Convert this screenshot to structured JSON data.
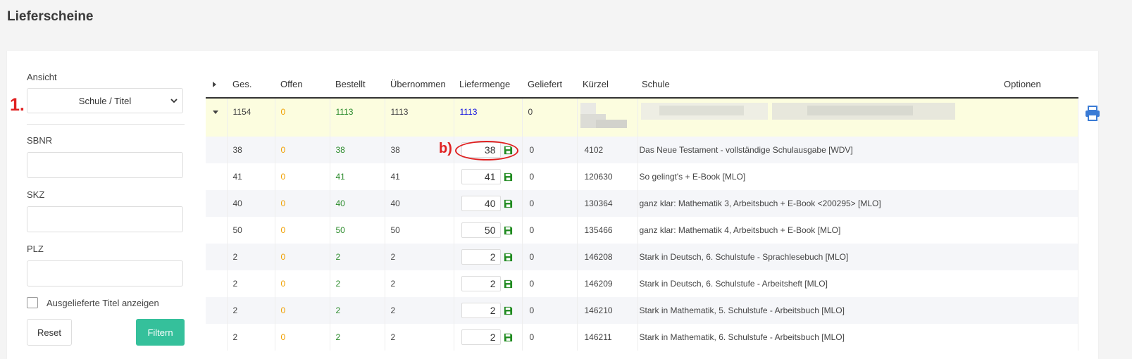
{
  "page": {
    "title": "Lieferscheine"
  },
  "filters": {
    "ansicht_label": "Ansicht",
    "ansicht_value": "Schule / Titel",
    "sbnr_label": "SBNR",
    "skz_label": "SKZ",
    "plz_label": "PLZ",
    "checkbox_label": "Ausgelieferte Titel anzeigen",
    "reset_label": "Reset",
    "filter_label": "Filtern"
  },
  "annotations": {
    "one": "1.",
    "b": "b)"
  },
  "table": {
    "headers": [
      "Ges.",
      "Offen",
      "Bestellt",
      "Übernommen",
      "Liefermenge",
      "Geliefert",
      "Kürzel",
      "Schule",
      "Optionen"
    ],
    "group": {
      "ges": "1154",
      "offen": "0",
      "bestellt": "1113",
      "uebernommen": "1113",
      "liefermenge": "1113",
      "geliefert": "0"
    },
    "rows": [
      {
        "ges": "38",
        "offen": "0",
        "bestellt": "38",
        "uebernommen": "38",
        "liefermenge": "38",
        "geliefert": "0",
        "kuerzel": "4102",
        "titel": "Das Neue Testament - vollständige Schulausgabe [WDV]"
      },
      {
        "ges": "41",
        "offen": "0",
        "bestellt": "41",
        "uebernommen": "41",
        "liefermenge": "41",
        "geliefert": "0",
        "kuerzel": "120630",
        "titel": "So gelingt's + E-Book [MLO]"
      },
      {
        "ges": "40",
        "offen": "0",
        "bestellt": "40",
        "uebernommen": "40",
        "liefermenge": "40",
        "geliefert": "0",
        "kuerzel": "130364",
        "titel": "ganz klar: Mathematik 3, Arbeitsbuch + E-Book <200295> [MLO]"
      },
      {
        "ges": "50",
        "offen": "0",
        "bestellt": "50",
        "uebernommen": "50",
        "liefermenge": "50",
        "geliefert": "0",
        "kuerzel": "135466",
        "titel": "ganz klar: Mathematik 4, Arbeitsbuch + E-Book [MLO]"
      },
      {
        "ges": "2",
        "offen": "0",
        "bestellt": "2",
        "uebernommen": "2",
        "liefermenge": "2",
        "geliefert": "0",
        "kuerzel": "146208",
        "titel": "Stark in Deutsch, 6. Schulstufe - Sprachlesebuch [MLO]"
      },
      {
        "ges": "2",
        "offen": "0",
        "bestellt": "2",
        "uebernommen": "2",
        "liefermenge": "2",
        "geliefert": "0",
        "kuerzel": "146209",
        "titel": "Stark in Deutsch, 6. Schulstufe - Arbeitsheft [MLO]"
      },
      {
        "ges": "2",
        "offen": "0",
        "bestellt": "2",
        "uebernommen": "2",
        "liefermenge": "2",
        "geliefert": "0",
        "kuerzel": "146210",
        "titel": "Stark in Mathematik, 5. Schulstufe - Arbeitsbuch [MLO]"
      },
      {
        "ges": "2",
        "offen": "0",
        "bestellt": "2",
        "uebernommen": "2",
        "liefermenge": "2",
        "geliefert": "0",
        "kuerzel": "146211",
        "titel": "Stark in Mathematik, 6. Schulstufe - Arbeitsbuch [MLO]"
      }
    ]
  },
  "colors": {
    "accent": "#35c09b",
    "annotation": "#e02020",
    "group_row_bg": "#fcfddf",
    "offen": "#f0a000",
    "bestellt": "#2a8a2a",
    "liefermenge_group": "#1010e0",
    "print_icon": "#3a7bd5",
    "save_icon": "#1f8a1f"
  },
  "icons": {
    "expand_all": "caret-right-icon",
    "group_toggle": "caret-down-icon",
    "print": "print-icon",
    "save": "save-icon",
    "select": "chevron-down-icon"
  }
}
